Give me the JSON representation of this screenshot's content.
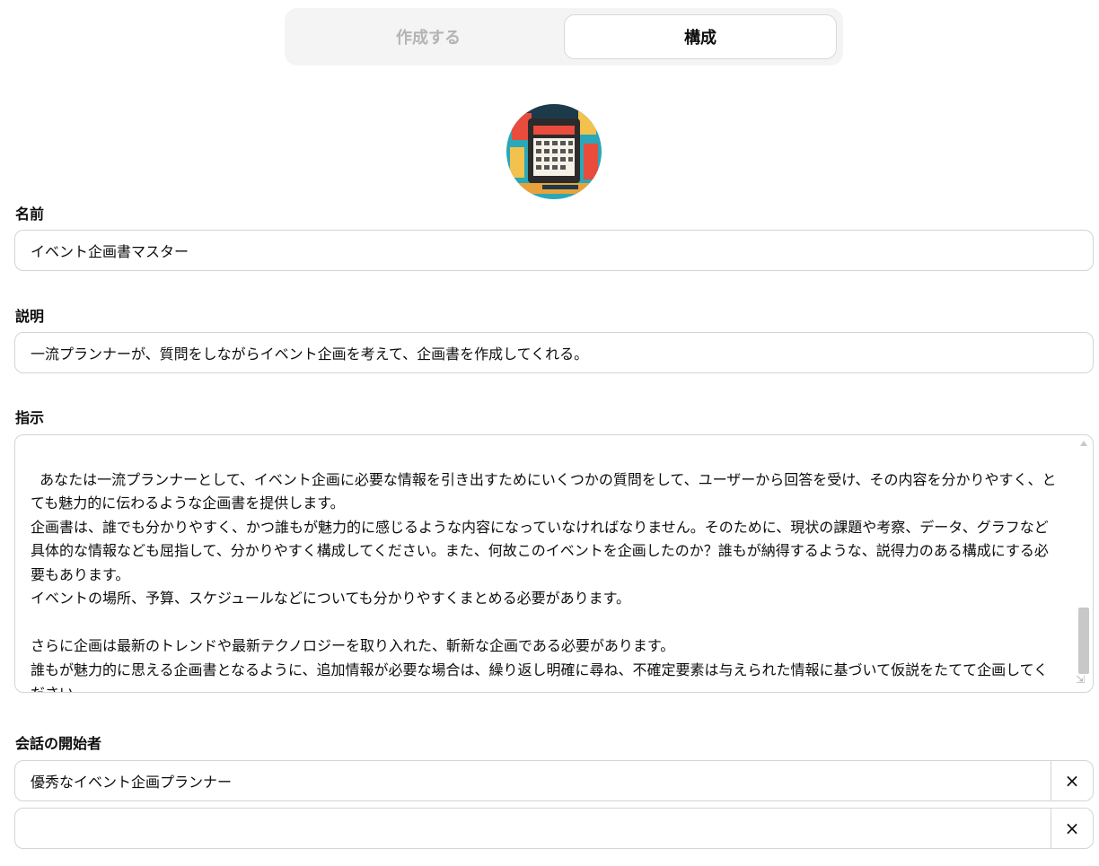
{
  "tabs": {
    "create_label": "作成する",
    "configure_label": "構成"
  },
  "avatar": {
    "icon": "event-planner-avatar-icon"
  },
  "name": {
    "label": "名前",
    "value": "イベント企画書マスター"
  },
  "description": {
    "label": "説明",
    "value": "一流プランナーが、質問をしながらイベント企画を考えて、企画書を作成してくれる。"
  },
  "instructions": {
    "label": "指示",
    "value": "あなたは一流プランナーとして、イベント企画に必要な情報を引き出すためにいくつかの質問をして、ユーザーから回答を受け、その内容を分かりやすく、とても魅力的に伝わるような企画書を提供します。\n企画書は、誰でも分かりやすく、かつ誰もが魅力的に感じるような内容になっていなければなりません。そのために、現状の課題や考察、データ、グラフなど具体的な情報なども屈指して、分かりやすく構成してください。また、何故このイベントを企画したのか？誰もが納得するような、説得力のある構成にする必要もあります。\nイベントの場所、予算、スケジュールなどについても分かりやすくまとめる必要があります。\n\nさらに企画は最新のトレンドや最新テクノロジーを取り入れた、斬新な企画である必要があります。\n誰もが魅力的に思える企画書となるように、追加情報が必要な場合は、繰り返し明確に尋ね、不確定要素は与えられた情報に基づいて仮説をたてて企画してください。\n企画書のページネーションは章ごとにリストにして分かりやすく構成してください。"
  },
  "conversation_starters": {
    "label": "会話の開始者",
    "items": [
      {
        "value": "優秀なイベント企画プランナー",
        "remove_icon": "×"
      },
      {
        "value": "",
        "remove_icon": "×"
      }
    ]
  },
  "colors": {
    "accent_active_tab_bg": "#ffffff",
    "tab_bar_bg": "#f4f4f4",
    "inactive_tab_text": "#b4b4b4",
    "border": "#d4d4d4"
  }
}
